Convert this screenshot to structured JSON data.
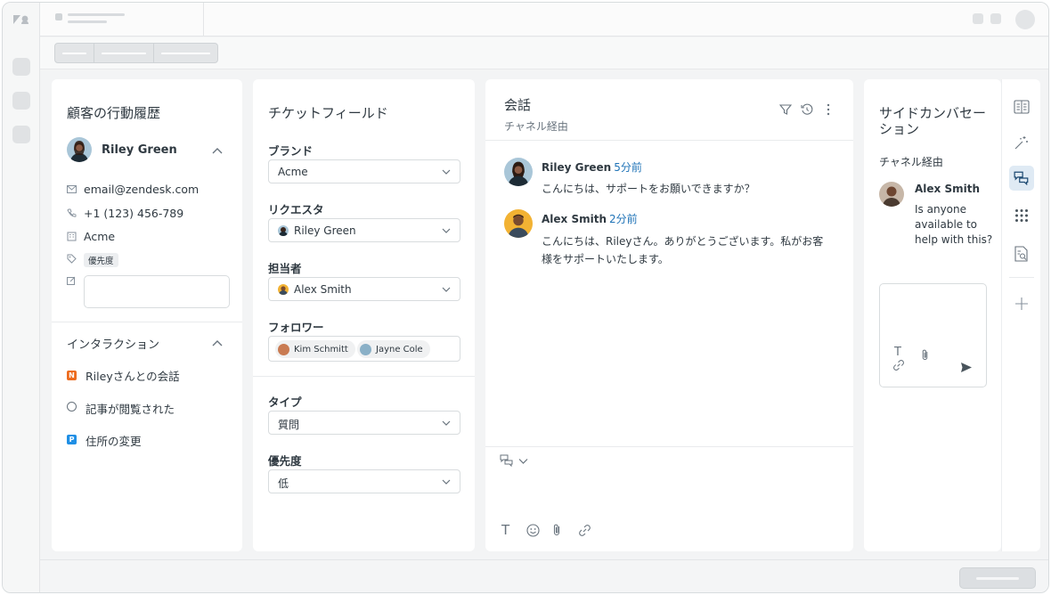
{
  "customer_panel": {
    "title": "顧客の行動履歴",
    "name": "Riley Green",
    "email": "email@zendesk.com",
    "phone": "+1 (123) 456-789",
    "company": "Acme",
    "tag": "優先度",
    "interactions_title": "インタラクション",
    "interactions": [
      {
        "badge": "N",
        "label": "Rileyさんとの会話"
      },
      {
        "badge": "",
        "label": "記事が閲覧された"
      },
      {
        "badge": "P",
        "label": "住所の変更"
      }
    ]
  },
  "ticket_fields": {
    "title": "チケットフィールド",
    "brand_label": "ブランド",
    "brand_value": "Acme",
    "requester_label": "リクエスタ",
    "requester_value": "Riley Green",
    "assignee_label": "担当者",
    "assignee_value": "Alex Smith",
    "followers_label": "フォロワー",
    "followers": [
      "Kim Schmitt",
      "Jayne Cole"
    ],
    "type_label": "タイプ",
    "type_value": "質問",
    "priority_label": "優先度",
    "priority_value": "低"
  },
  "conversation": {
    "title": "会話",
    "subtitle": "チャネル経由",
    "messages": [
      {
        "name": "Riley Green",
        "time": "5分前",
        "text": "こんにちは、サポートをお願いできますか？"
      },
      {
        "name": "Alex Smith",
        "time": "2分前",
        "text1": "こんにちは、Rileyさん。ありがとうございます。私がお客",
        "text2": "様をサポートいたします。"
      }
    ]
  },
  "side_conversation": {
    "title1": "サイドカンバセー",
    "title2": "ション",
    "subtitle": "チャネル経由",
    "name": "Alex Smith",
    "msg1": "Is anyone",
    "msg2": "available to",
    "msg3": "help with this?"
  },
  "colors": {
    "accent_blue": "#1f73b7",
    "badge_orange": "#ed6c1f",
    "badge_blue": "#1f8fe5"
  }
}
